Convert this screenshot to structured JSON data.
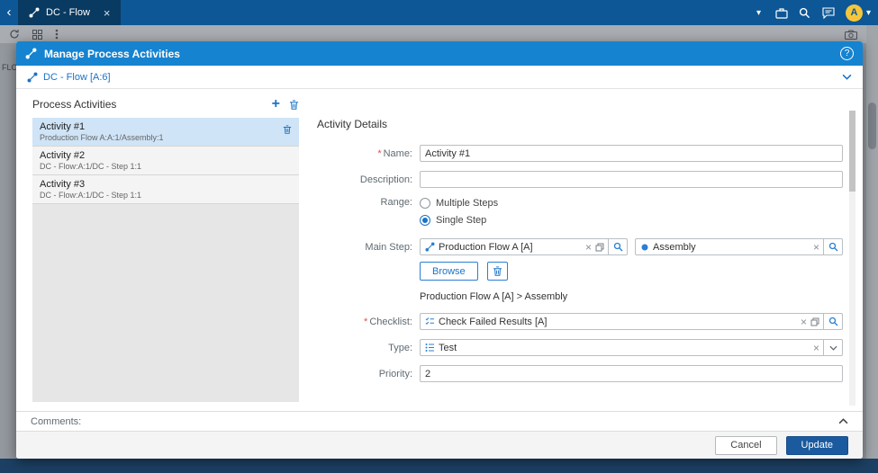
{
  "icons": {
    "close": "×",
    "plus": "+",
    "question": "?",
    "caret_down": "▾",
    "chevron_left": "‹"
  },
  "titlebar": {
    "tab_label": "DC - Flow",
    "avatar_initial": "A"
  },
  "background": {
    "side_text": "FLO"
  },
  "modal": {
    "title": "Manage Process Activities",
    "context_label": "DC - Flow [A:6]",
    "required_mark": "*",
    "activities": {
      "title": "Process Activities",
      "items": [
        {
          "name": "Activity #1",
          "subtitle": "Production Flow A:A:1/Assembly:1"
        },
        {
          "name": "Activity #2",
          "subtitle": "DC - Flow:A:1/DC - Step 1:1"
        },
        {
          "name": "Activity #3",
          "subtitle": "DC - Flow:A:1/DC - Step 1:1"
        }
      ]
    },
    "details": {
      "title": "Activity Details",
      "name_label": "Name:",
      "name_value": "Activity #1",
      "description_label": "Description:",
      "description_value": "",
      "range_label": "Range:",
      "range_options": [
        "Multiple Steps",
        "Single Step"
      ],
      "range_selected": "Single Step",
      "main_step_label": "Main Step:",
      "main_step_flow": "Production Flow A [A]",
      "main_step_step": "Assembly",
      "browse_label": "Browse",
      "path_text": "Production Flow A [A] > Assembly",
      "checklist_label": "Checklist:",
      "checklist_value": "Check Failed Results [A]",
      "type_label": "Type:",
      "type_value": "Test",
      "priority_label": "Priority:",
      "priority_value": "2"
    },
    "comments_label": "Comments:",
    "footer": {
      "cancel": "Cancel",
      "update": "Update"
    }
  }
}
